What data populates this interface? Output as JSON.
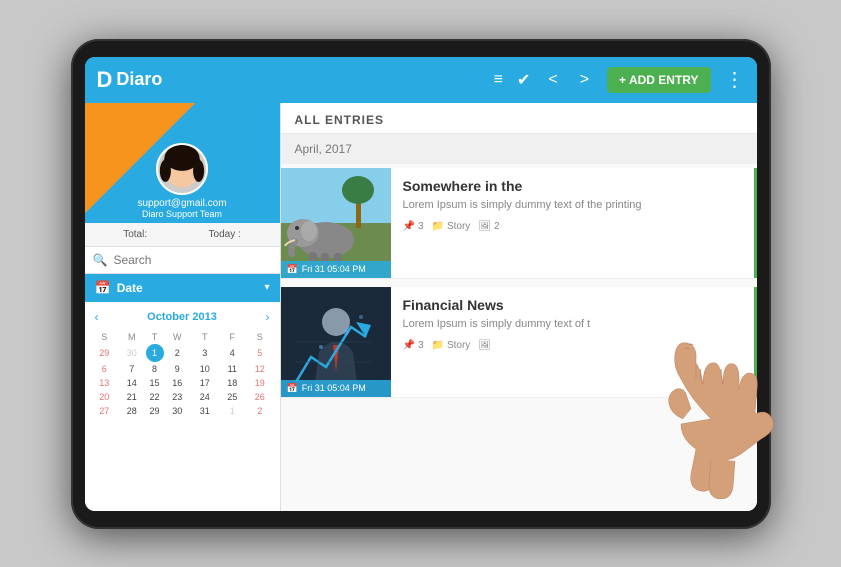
{
  "app": {
    "name": "Diaro",
    "logo_letter": "D"
  },
  "toolbar": {
    "add_entry_label": "+ ADD ENTRY",
    "nav_back": "<",
    "nav_forward": ">"
  },
  "sidebar": {
    "profile": {
      "email": "support@gmail.com",
      "team": "Diaro Support Team"
    },
    "stats": {
      "total_label": "Total:",
      "today_label": "Today :"
    },
    "search": {
      "placeholder": "Search"
    },
    "date_section": {
      "label": "Date"
    },
    "calendar": {
      "month": "October 2013",
      "days_header": [
        "S",
        "M",
        "T",
        "W",
        "T",
        "F",
        "S"
      ],
      "weeks": [
        [
          "29",
          "30",
          "1",
          "2",
          "3",
          "4",
          "5"
        ],
        [
          "6",
          "7",
          "8",
          "9",
          "10",
          "11",
          "12"
        ],
        [
          "13",
          "14",
          "15",
          "16",
          "17",
          "18",
          "19"
        ],
        [
          "20",
          "21",
          "22",
          "23",
          "24",
          "25",
          "26"
        ],
        [
          "27",
          "28",
          "29",
          "30",
          "31",
          "1",
          "2"
        ]
      ],
      "today_date": "1"
    }
  },
  "content": {
    "header": "ALL ENTRIES",
    "section_date": "April, 2017",
    "entries": [
      {
        "id": 1,
        "title": "Somewhere in the",
        "excerpt": "Lorem Ipsum is simply dummy text of the printing",
        "date_label": "Fri 31  05:04 PM",
        "tags": "3",
        "category": "Story",
        "images": "2",
        "thumb_type": "elephant"
      },
      {
        "id": 2,
        "title": "Financial News",
        "excerpt": "Lorem Ipsum is simply dummy text of t",
        "date_label": "Fri 31  05:04 PM",
        "tags": "3",
        "category": "Story",
        "images": "",
        "thumb_type": "business"
      }
    ]
  },
  "icons": {
    "list": "☰",
    "check": "✓",
    "more": "⋮",
    "search": "🔍",
    "calendar": "📅",
    "pin": "📌",
    "folder": "📁",
    "image": "🖼",
    "chevron_left": "‹",
    "chevron_right": "›"
  }
}
